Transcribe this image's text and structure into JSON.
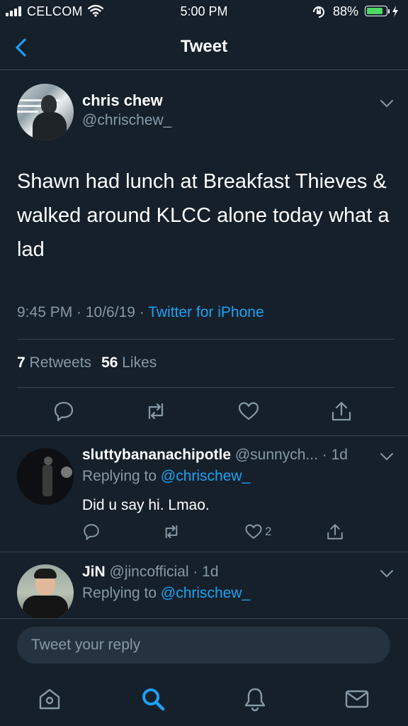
{
  "status_bar": {
    "carrier": "CELCOM",
    "time": "5:00 PM",
    "battery_percent": "88%",
    "battery_level": 0.88,
    "icons": [
      "signal-icon",
      "wifi-icon",
      "rotation-lock-icon",
      "battery-icon",
      "charging-icon"
    ]
  },
  "nav": {
    "title": "Tweet",
    "back_icon": "chevron-left-icon"
  },
  "tweet": {
    "name": "chris chew",
    "handle": "@chrischew_",
    "text": "Shawn had lunch at Breakfast Thieves & walked around KLCC alone today what a lad",
    "meta": "9:45 PM · 10/6/19 · ",
    "source": "Twitter for iPhone",
    "retweets_count": "7",
    "retweets_label": " Retweets",
    "likes_count": "56",
    "likes_label": " Likes",
    "actions": [
      "reply-icon",
      "retweet-icon",
      "like-icon",
      "share-icon"
    ]
  },
  "replies": [
    {
      "name": "sluttybananachipotle",
      "handle_time": " @sunnych... · 1d",
      "replying_prefix": "Replying to ",
      "replying_handle": "@chrischew_",
      "text": "Did u say hi.  Lmao.",
      "like_count": "2"
    },
    {
      "name": "JiN",
      "handle_time": " @jincofficial · 1d",
      "replying_prefix": "Replying to ",
      "replying_handle": "@chrischew_"
    }
  ],
  "composer": {
    "placeholder": "Tweet your reply"
  },
  "tab_bar": [
    "home-icon",
    "search-icon",
    "notifications-icon",
    "messages-icon"
  ],
  "colors": {
    "background": "#15202b",
    "accent": "#1da1f2",
    "secondary_text": "#8899a6",
    "divider": "#38444d",
    "composer": "#253341"
  }
}
